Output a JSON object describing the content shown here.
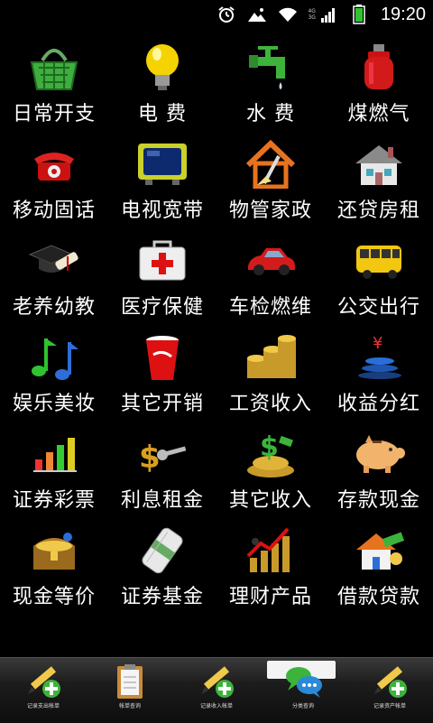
{
  "status_bar": {
    "network_top": "4G",
    "network_bottom": "3G",
    "time": "19:20"
  },
  "grid": [
    {
      "label": "日常开支",
      "icon": "shopping-basket-icon"
    },
    {
      "label": "电 费",
      "icon": "light-bulb-icon"
    },
    {
      "label": "水 费",
      "icon": "water-faucet-icon"
    },
    {
      "label": "煤燃气",
      "icon": "gas-cylinder-icon"
    },
    {
      "label": "移动固话",
      "icon": "telephone-icon"
    },
    {
      "label": "电视宽带",
      "icon": "television-icon"
    },
    {
      "label": "物管家政",
      "icon": "house-broom-icon"
    },
    {
      "label": "还贷房租",
      "icon": "house-icon"
    },
    {
      "label": "老养幼教",
      "icon": "graduation-cap-icon"
    },
    {
      "label": "医疗保健",
      "icon": "first-aid-kit-icon"
    },
    {
      "label": "车检燃维",
      "icon": "red-car-icon"
    },
    {
      "label": "公交出行",
      "icon": "bus-icon"
    },
    {
      "label": "娱乐美妆",
      "icon": "music-notes-icon"
    },
    {
      "label": "其它开销",
      "icon": "cola-cup-icon"
    },
    {
      "label": "工资收入",
      "icon": "coin-stacks-icon"
    },
    {
      "label": "收益分红",
      "icon": "yen-coins-icon"
    },
    {
      "label": "证券彩票",
      "icon": "bar-chart-icon"
    },
    {
      "label": "利息租金",
      "icon": "dollar-key-icon"
    },
    {
      "label": "其它收入",
      "icon": "money-pile-icon"
    },
    {
      "label": "存款现金",
      "icon": "piggy-bank-icon"
    },
    {
      "label": "现金等价",
      "icon": "treasure-chest-icon"
    },
    {
      "label": "证券基金",
      "icon": "money-roll-icon"
    },
    {
      "label": "理财产品",
      "icon": "graph-figurines-icon"
    },
    {
      "label": "借款贷款",
      "icon": "house-money-icon"
    }
  ],
  "tabs": [
    {
      "label": "记录支出帐单",
      "icon": "pencil-add-icon",
      "active": false
    },
    {
      "label": "帐单查询",
      "icon": "clipboard-icon",
      "active": false
    },
    {
      "label": "记录收入帐单",
      "icon": "pencil-add-icon",
      "active": false
    },
    {
      "label": "分类查询",
      "icon": "chat-bubbles-icon",
      "active": true
    },
    {
      "label": "记录资产帐单",
      "icon": "pencil-add-icon",
      "active": false
    }
  ],
  "colors": {
    "background": "#000000",
    "text": "#ffffff",
    "battery": "#2fc42f"
  }
}
